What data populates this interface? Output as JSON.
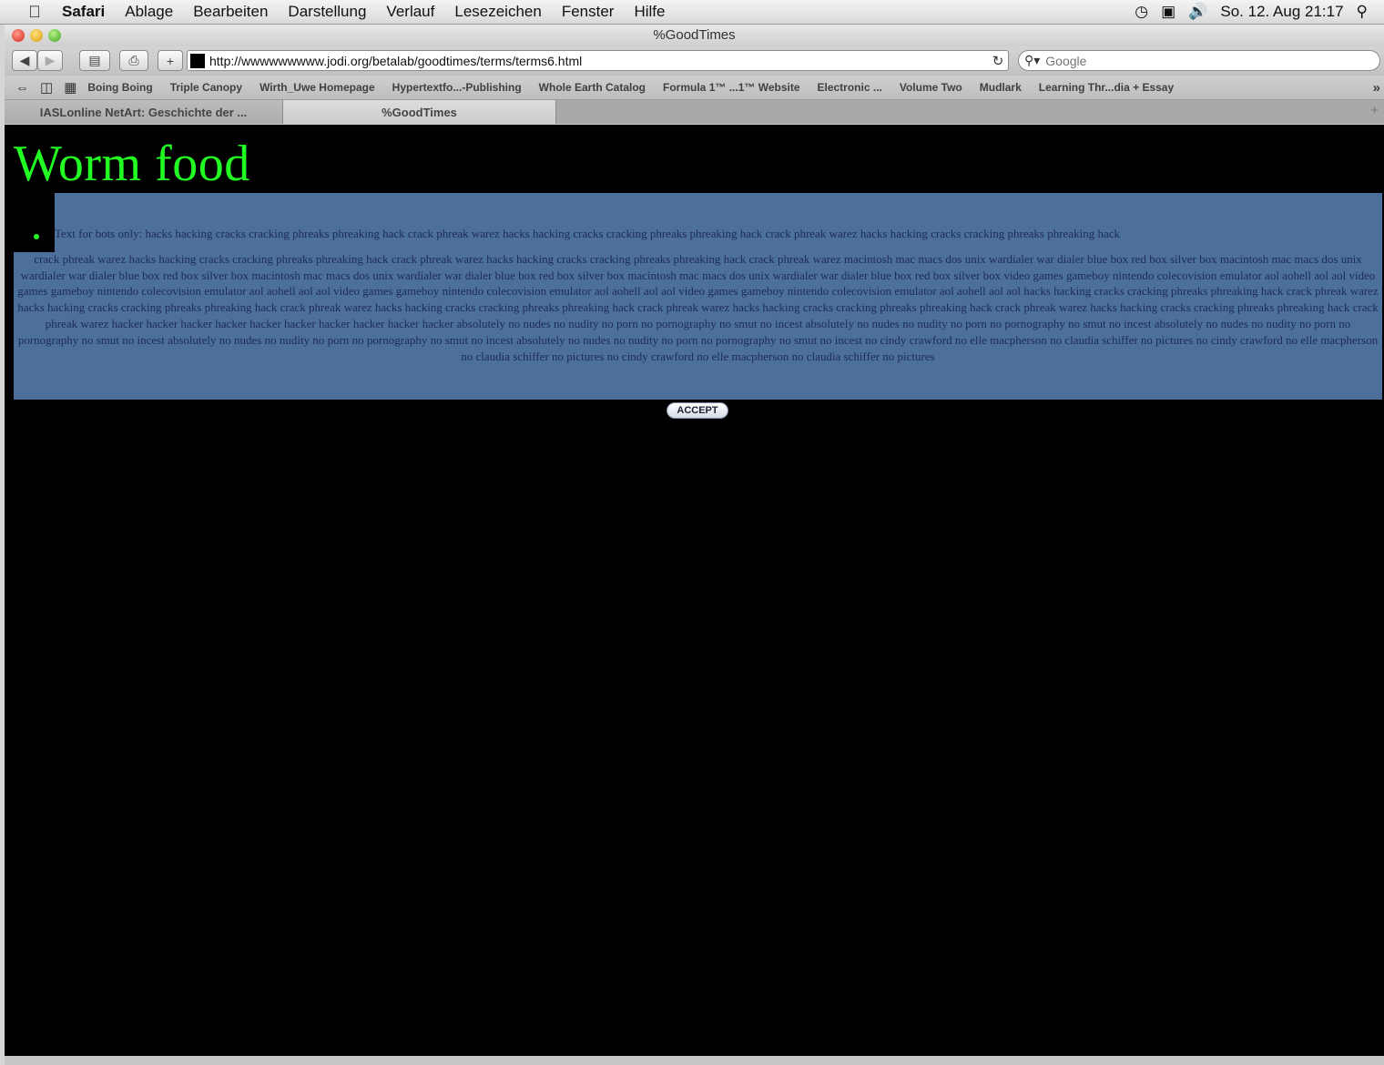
{
  "menubar": {
    "apple": "",
    "items": [
      "Safari",
      "Ablage",
      "Bearbeiten",
      "Darstellung",
      "Verlauf",
      "Lesezeichen",
      "Fenster",
      "Hilfe"
    ],
    "clock": "So. 12. Aug  21:17"
  },
  "window": {
    "title": "%GoodTimes"
  },
  "toolbar": {
    "url": "http://wwwwwwwww.jodi.org/betalab/goodtimes/terms/terms6.html",
    "search_placeholder": "Google"
  },
  "bookmarks": {
    "items": [
      "Boing Boing",
      "Triple Canopy",
      "Wirth_Uwe Homepage",
      "Hypertextfo...-Publishing",
      "Whole Earth Catalog",
      "Formula 1™ ...1™ Website",
      "Electronic ...",
      "Volume Two",
      "Mudlark",
      "Learning Thr...dia + Essay"
    ],
    "more": "»"
  },
  "tabs": [
    {
      "label": "IASLonline NetArt: Geschichte der ..."
    },
    {
      "label": "%GoodTimes"
    }
  ],
  "page": {
    "heading": "Worm food",
    "text_first_line": "Text for bots only: hacks hacking cracks cracking phreaks phreaking hack crack phreak warez hacks hacking cracks cracking phreaks phreaking hack crack phreak warez hacks hacking cracks cracking phreaks phreaking hack",
    "text_body": "crack phreak warez hacks hacking cracks cracking phreaks phreaking hack crack phreak warez hacks hacking cracks cracking phreaks phreaking hack crack phreak warez macintosh mac macs dos unix wardialer war dialer blue box red box silver box macintosh mac macs dos unix wardialer war dialer blue box red box silver box macintosh mac macs dos unix wardialer war dialer blue box red box silver box macintosh mac macs dos unix wardialer war dialer blue box red box silver box video games gameboy nintendo colecovision emulator aol aohell aol aol video games gameboy nintendo colecovision emulator aol aohell aol aol video games gameboy nintendo colecovision emulator aol aohell aol aol video games gameboy nintendo colecovision emulator aol aohell aol aol hacks hacking cracks cracking phreaks phreaking hack crack phreak warez hacks hacking cracks cracking phreaks phreaking hack crack phreak warez hacks hacking cracks cracking phreaks phreaking hack crack phreak warez hacks hacking cracks cracking phreaks phreaking hack crack phreak warez hacks hacking cracks cracking phreaks phreaking hack crack phreak warez hacker hacker hacker hacker hacker hacker hacker hacker hacker hacker absolutely no nudes no nudity no porn no pornography no smut no incest absolutely no nudes no nudity no porn no pornography no smut no incest absolutely no nudes no nudity no porn no pornography no smut no incest absolutely no nudes no nudity no porn no pornography no smut no incest absolutely no nudes no nudity no porn no pornography no smut no incest no cindy crawford no elle macpherson no claudia schiffer no pictures no cindy crawford no elle macpherson no claudia schiffer no pictures no cindy crawford no elle macpherson no claudia schiffer no pictures",
    "accept_label": "ACCEPT"
  },
  "colors": {
    "heading": "#22ff22",
    "selection": "#4c6f9c",
    "background": "#000000"
  }
}
